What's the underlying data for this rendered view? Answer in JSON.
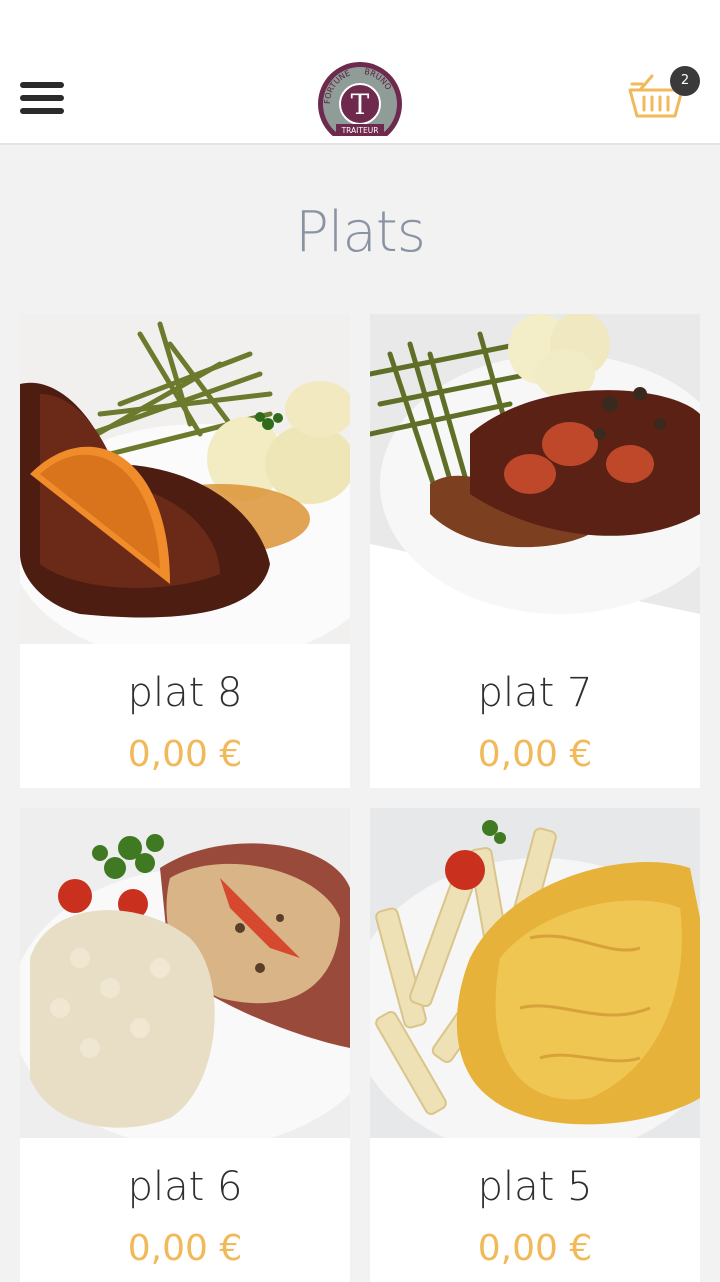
{
  "header": {
    "menu_icon": "hamburger-menu-icon",
    "logo": {
      "top_left_text": "FORTUNE",
      "top_right_text": "BRUNO",
      "bottom_text": "TRAITEUR",
      "letter": "T",
      "ring_color": "#7a8a86",
      "inner_color": "#6e2a4c"
    },
    "cart": {
      "icon": "basket-icon",
      "count": "2",
      "color": "#f0b95a"
    }
  },
  "page": {
    "title": "Plats"
  },
  "products": [
    {
      "name": "plat 8",
      "price": "0,00 €",
      "image": "duck-leg-orange-beans-potatoes"
    },
    {
      "name": "plat 7",
      "price": "0,00 €",
      "image": "beef-mushroom-sauce-beans-potatoes"
    },
    {
      "name": "plat 6",
      "price": "0,00 €",
      "image": "ham-mushroom-sauce-rice"
    },
    {
      "name": "plat 5",
      "price": "0,00 €",
      "image": "omelette-penne-pasta"
    }
  ],
  "colors": {
    "price": "#f0b95a",
    "title": "#8a93a3",
    "background": "#f2f2f2"
  }
}
